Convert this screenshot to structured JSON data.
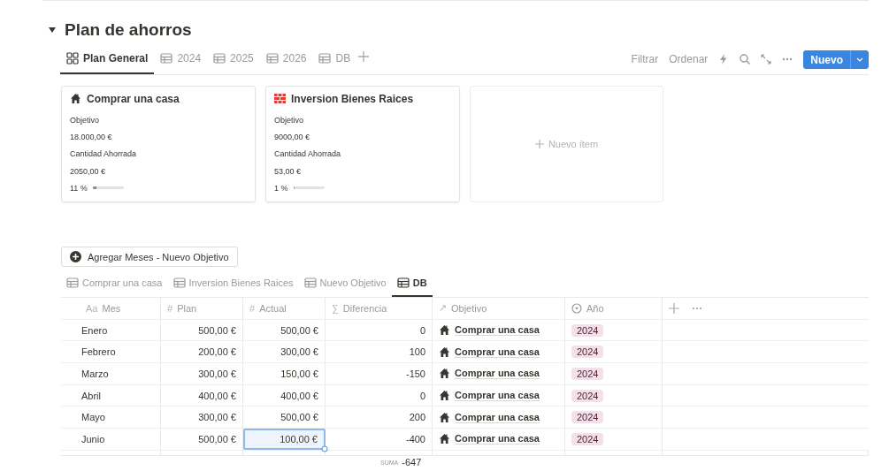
{
  "title": "Plan de ahorros",
  "view_tabs": [
    {
      "label": "Plan General",
      "kind": "board",
      "selected": true
    },
    {
      "label": "2024",
      "kind": "table",
      "selected": false
    },
    {
      "label": "2025",
      "kind": "table",
      "selected": false
    },
    {
      "label": "2026",
      "kind": "table",
      "selected": false
    },
    {
      "label": "DB",
      "kind": "table",
      "selected": false
    }
  ],
  "toolbar": {
    "filter": "Filtrar",
    "sort": "Ordenar",
    "new_button": "Nuevo"
  },
  "cards": [
    {
      "kind": "house",
      "title": "Comprar una casa",
      "fields": [
        "Objetivo",
        "18.000,00 €",
        "Cantidad Ahorrada",
        "2050,00 €"
      ],
      "percent": "11 %",
      "level": 0.11
    },
    {
      "kind": "bricks",
      "title": "Inversion Bienes Raices",
      "fields": [
        "Objetivo",
        "9000,00 €",
        "Cantidad Ahorrada",
        "53,00 €"
      ],
      "percent": "1 %",
      "level": 0.01
    }
  ],
  "new_item": "Nuevo ítem",
  "action_button": "Agregar Meses - Nuevo Objetivo",
  "table_tabs": [
    {
      "label": "Comprar una casa",
      "selected": false
    },
    {
      "label": "Inversion Bienes Raices",
      "selected": false
    },
    {
      "label": "Nuevo Objetivo",
      "selected": false
    },
    {
      "label": "DB",
      "selected": true
    }
  ],
  "table": {
    "columns": [
      {
        "icon": "Aa",
        "label": "Mes"
      },
      {
        "icon": "#",
        "label": "Plan"
      },
      {
        "icon": "#",
        "label": "Actual"
      },
      {
        "icon": "∑",
        "label": "Diferencia"
      },
      {
        "icon": "↗",
        "label": "Objetivo"
      },
      {
        "kind": "select",
        "label": "Año"
      }
    ],
    "rows": [
      {
        "cells": [
          {
            "text": "Enero",
            "selected": false
          },
          {
            "text": "500,00 €",
            "selected": false
          },
          {
            "text": "500,00 €",
            "selected": false
          },
          {
            "text": "0",
            "selected": false
          }
        ],
        "objetivo": "Comprar una casa",
        "year": "2024"
      },
      {
        "cells": [
          {
            "text": "Febrero",
            "selected": false
          },
          {
            "text": "200,00 €",
            "selected": false
          },
          {
            "text": "300,00 €",
            "selected": false
          },
          {
            "text": "100",
            "selected": false
          }
        ],
        "objetivo": "Comprar una casa",
        "year": "2024"
      },
      {
        "cells": [
          {
            "text": "Marzo",
            "selected": false
          },
          {
            "text": "300,00 €",
            "selected": false
          },
          {
            "text": "150,00 €",
            "selected": false
          },
          {
            "text": "-150",
            "selected": false
          }
        ],
        "objetivo": "Comprar una casa",
        "year": "2024"
      },
      {
        "cells": [
          {
            "text": "Abril",
            "selected": false
          },
          {
            "text": "400,00 €",
            "selected": false
          },
          {
            "text": "400,00 €",
            "selected": false
          },
          {
            "text": "0",
            "selected": false
          }
        ],
        "objetivo": "Comprar una casa",
        "year": "2024"
      },
      {
        "cells": [
          {
            "text": "Mayo",
            "selected": false
          },
          {
            "text": "300,00 €",
            "selected": false
          },
          {
            "text": "500,00 €",
            "selected": false
          },
          {
            "text": "200",
            "selected": false
          }
        ],
        "objetivo": "Comprar una casa",
        "year": "2024"
      },
      {
        "cells": [
          {
            "text": "Junio",
            "selected": false
          },
          {
            "text": "500,00 €",
            "selected": false
          },
          {
            "text": "100,00 €",
            "selected": true
          },
          {
            "text": "-400",
            "selected": false
          }
        ],
        "objetivo": "Comprar una casa",
        "year": "2024"
      }
    ],
    "footer": {
      "label": "SUMA",
      "value": "-647"
    }
  }
}
